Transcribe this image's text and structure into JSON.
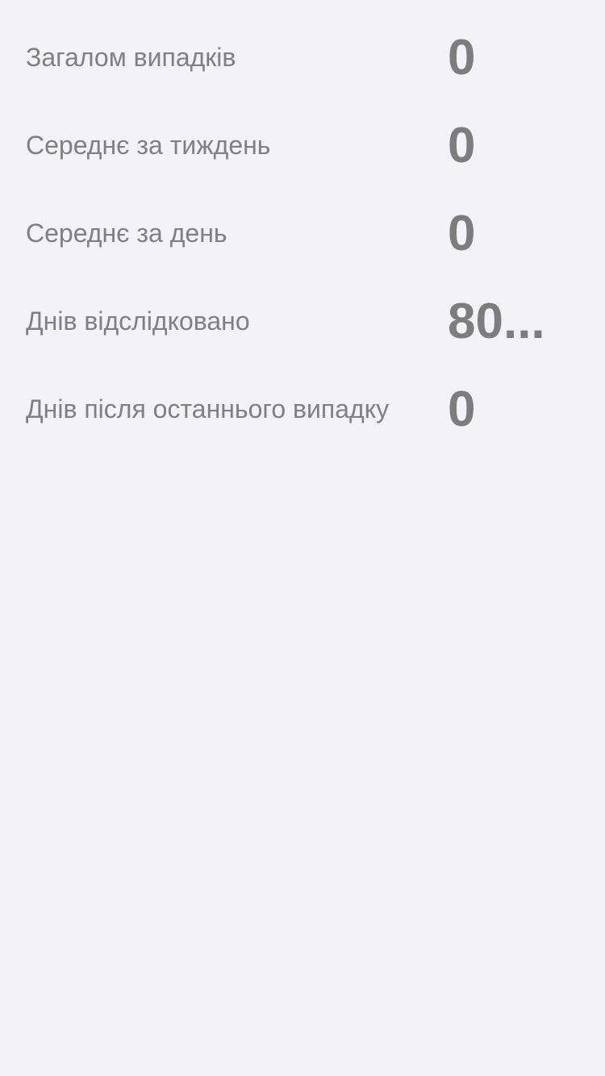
{
  "stats": [
    {
      "label": "Загалом випадків",
      "value": "0"
    },
    {
      "label": "Середнє за тиждень",
      "value": "0"
    },
    {
      "label": "Середнє за день",
      "value": "0"
    },
    {
      "label": "Днів відслідковано",
      "value": "80..."
    },
    {
      "label": "Днів після останнього випадку",
      "value": "0"
    }
  ]
}
